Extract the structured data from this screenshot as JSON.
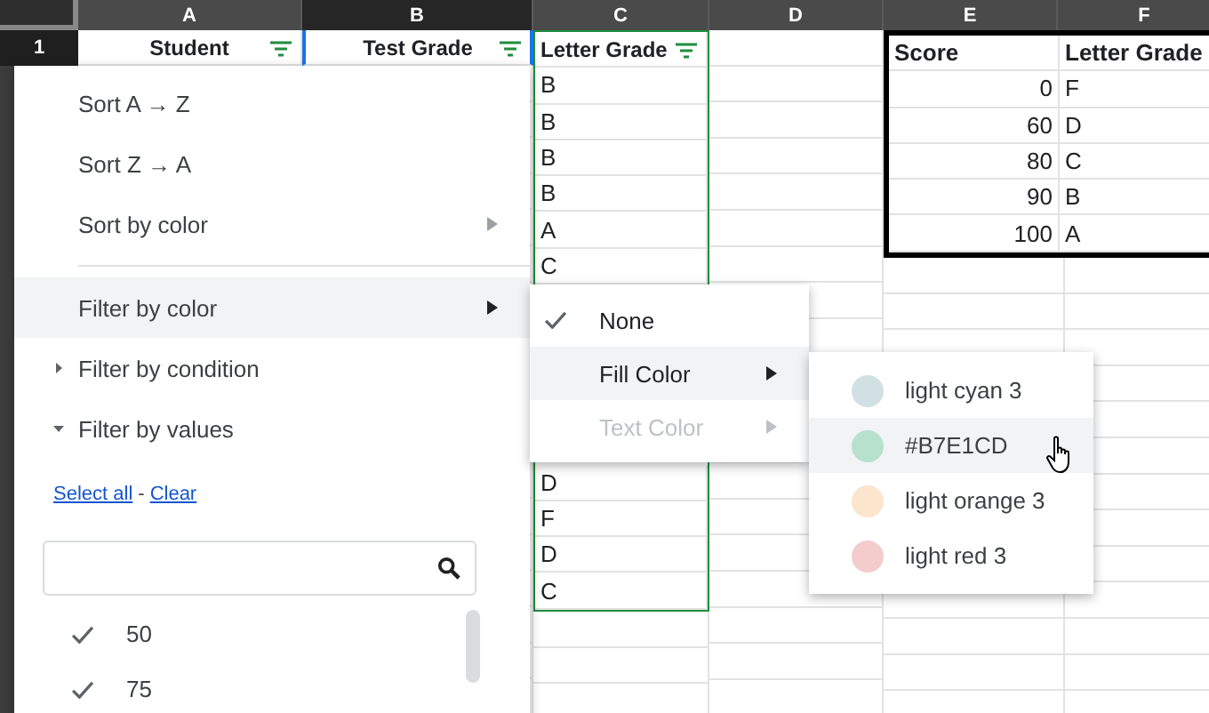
{
  "columns": [
    {
      "label": "A",
      "selected": false
    },
    {
      "label": "B",
      "selected": true
    },
    {
      "label": "C",
      "selected": false
    },
    {
      "label": "D",
      "selected": false
    },
    {
      "label": "E",
      "selected": false
    },
    {
      "label": "F",
      "selected": false
    }
  ],
  "row_number": "1",
  "headers": [
    "Student",
    "Test Grade",
    "Letter Grade"
  ],
  "letter_grades_top": [
    "B",
    "B",
    "B",
    "B",
    "A",
    "C"
  ],
  "letter_grades_bottom": [
    "D",
    "F",
    "D",
    "C"
  ],
  "lookup_table": {
    "headers": [
      "Score",
      "Letter Grade"
    ],
    "rows": [
      [
        "0",
        "F"
      ],
      [
        "60",
        "D"
      ],
      [
        "80",
        "C"
      ],
      [
        "90",
        "B"
      ],
      [
        "100",
        "A"
      ]
    ]
  },
  "filter_menu": {
    "sort_items": [
      {
        "kind": "action",
        "label": "Sort A → Z",
        "selected": false
      },
      {
        "kind": "action",
        "label": "Sort Z → A",
        "selected": false
      },
      {
        "kind": "submenu",
        "label": "Sort by color",
        "selected": false
      }
    ],
    "filter_items": [
      {
        "kind": "submenu",
        "label": "Filter by color",
        "selected": true
      },
      {
        "kind": "section",
        "label": "Filter by condition",
        "selected": false,
        "expanded": false
      },
      {
        "kind": "section",
        "label": "Filter by values",
        "selected": false,
        "expanded": true
      }
    ],
    "links": [
      "Select all",
      "Clear"
    ],
    "link_separator": "-",
    "values": [
      {
        "label": "50",
        "checked": true
      },
      {
        "label": "75",
        "checked": true
      }
    ]
  },
  "color_menu": [
    {
      "kind": "option",
      "label": "None",
      "checked": true,
      "selected": false,
      "disabled": false
    },
    {
      "kind": "submenu",
      "label": "Fill Color",
      "checked": false,
      "selected": true,
      "disabled": false
    },
    {
      "kind": "submenu",
      "label": "Text Color",
      "checked": false,
      "selected": false,
      "disabled": true
    }
  ],
  "fill_colors": [
    {
      "label": "light cyan 3",
      "color": "#d0e0e3",
      "selected": false
    },
    {
      "label": "#B7E1CD",
      "color": "#b7e1cd",
      "selected": true
    },
    {
      "label": "light orange 3",
      "color": "#fce5cd",
      "selected": false
    },
    {
      "label": "light red 3",
      "color": "#f4cccc",
      "selected": false
    }
  ]
}
